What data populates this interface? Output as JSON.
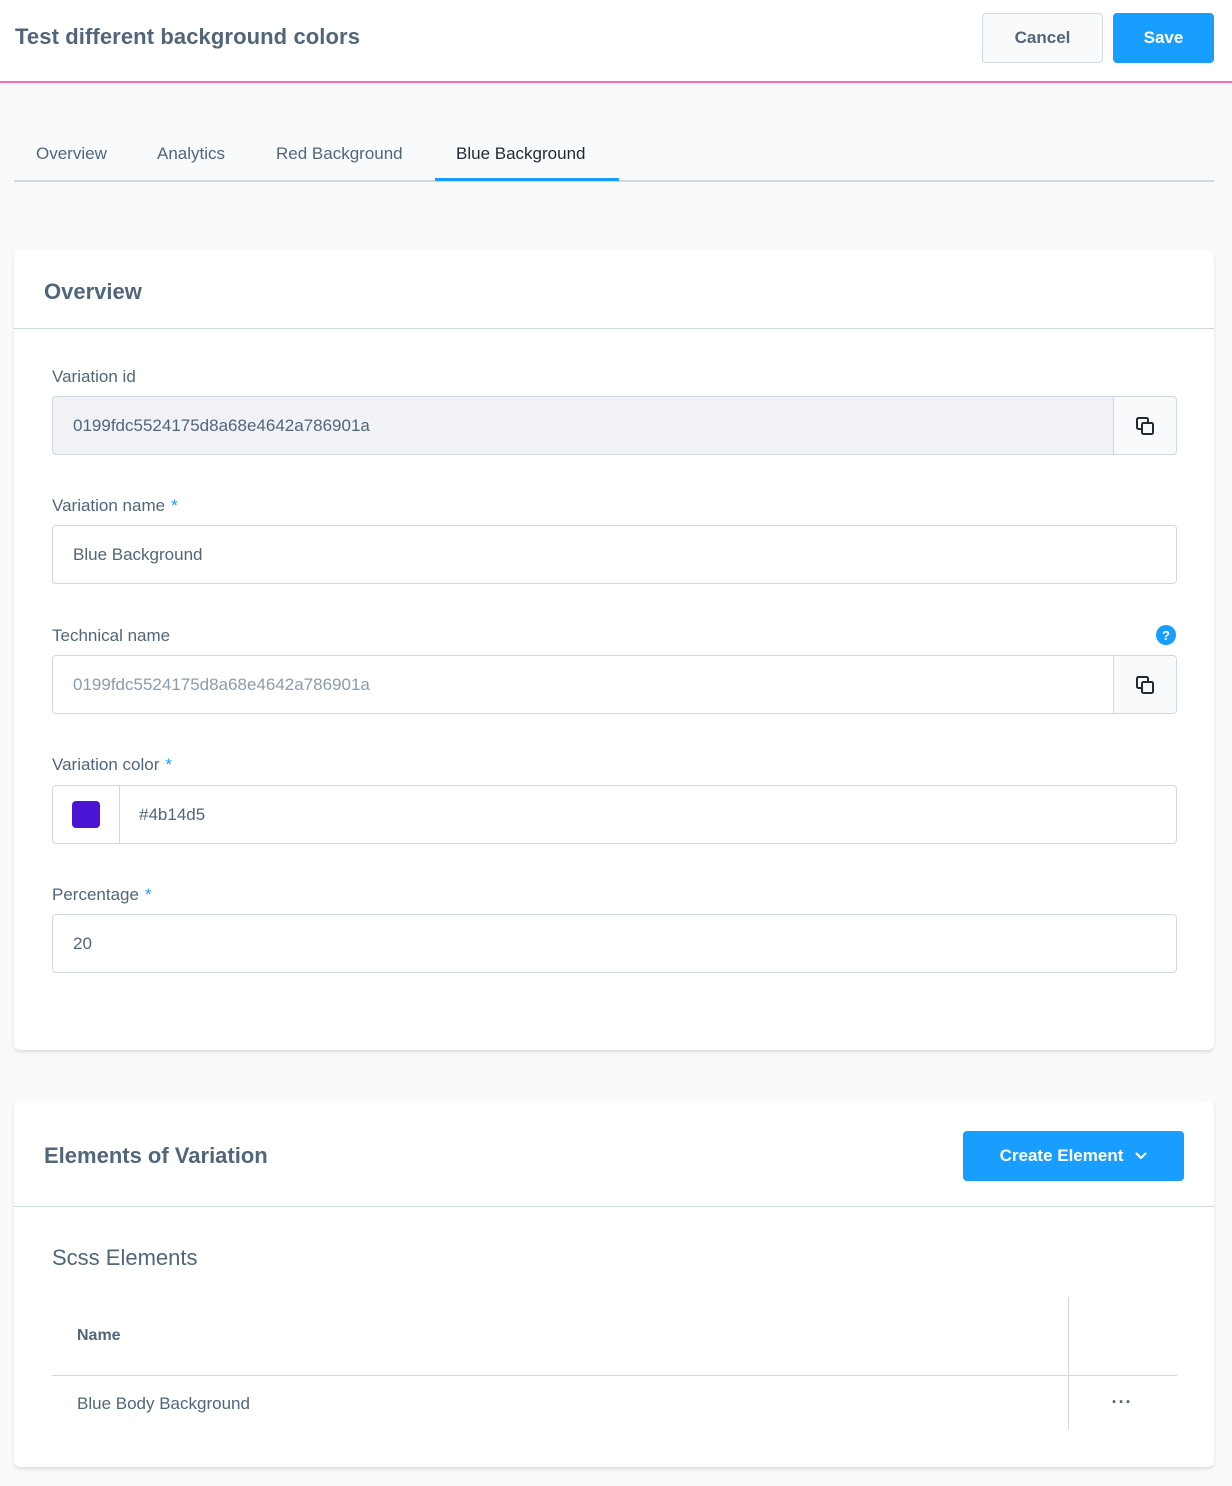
{
  "header": {
    "title": "Test different background colors",
    "cancel_label": "Cancel",
    "save_label": "Save",
    "accent_color": "#ff68b4"
  },
  "tabs": [
    {
      "label": "Overview",
      "active": false
    },
    {
      "label": "Analytics",
      "active": false
    },
    {
      "label": "Red Background",
      "active": false
    },
    {
      "label": "Blue Background",
      "active": true
    }
  ],
  "overview": {
    "title": "Overview",
    "variation_id": {
      "label": "Variation id",
      "value": "0199fdc5524175d8a68e4642a786901a",
      "icon": "copy-icon"
    },
    "variation_name": {
      "label": "Variation name",
      "required_mark": "*",
      "value": "Blue Background"
    },
    "technical_name": {
      "label": "Technical name",
      "placeholder": "0199fdc5524175d8a68e4642a786901a",
      "help_glyph": "?",
      "icon": "copy-icon"
    },
    "variation_color": {
      "label": "Variation color",
      "required_mark": "*",
      "value": "#4b14d5",
      "swatch_color": "#4b14d5"
    },
    "percentage": {
      "label": "Percentage",
      "required_mark": "*",
      "value": "20"
    }
  },
  "elements": {
    "title": "Elements of Variation",
    "create_label": "Create Element",
    "section_title": "Scss Elements",
    "columns": [
      "Name"
    ],
    "rows": [
      {
        "name": "Blue Body Background",
        "actions": "···"
      }
    ]
  },
  "colors": {
    "primary": "#189eff",
    "text": "#52667a",
    "border": "#d1d9e0"
  }
}
